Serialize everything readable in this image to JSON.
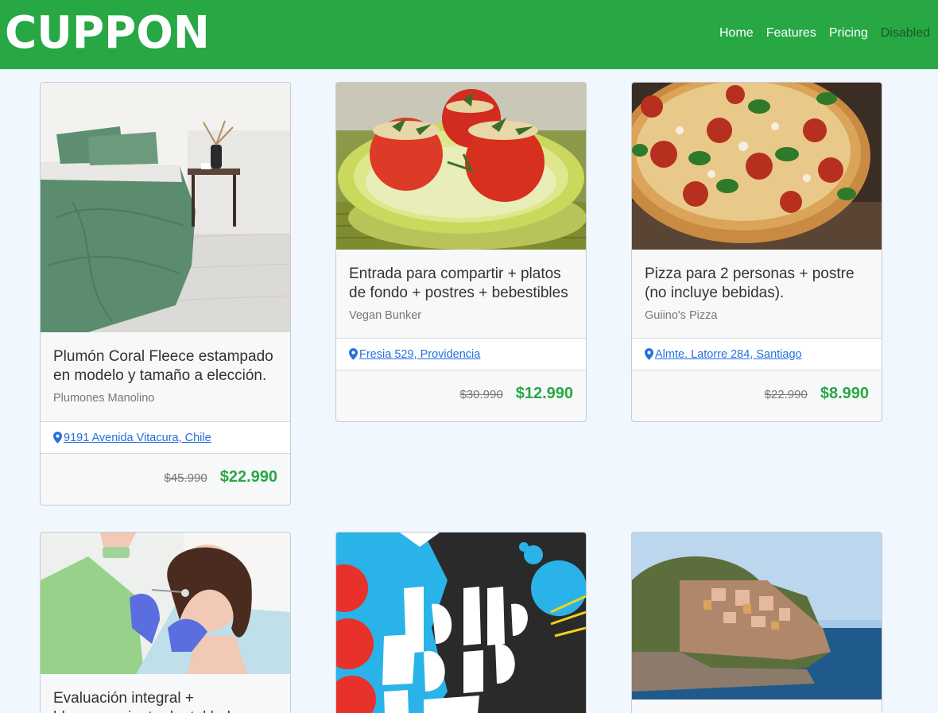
{
  "navbar": {
    "brand": "CUPPON",
    "links": [
      {
        "label": "Home"
      },
      {
        "label": "Features"
      },
      {
        "label": "Pricing"
      },
      {
        "label": "Disabled"
      }
    ]
  },
  "cards": [
    {
      "title": "Plumón Coral Fleece estampado en modelo y tamaño a elección.",
      "shop": "Plumones Manolino",
      "address": "9191 Avenida Vitacura, Chile",
      "old_price": "$45.990",
      "new_price": "$22.990"
    },
    {
      "title": "Entrada para compartir + platos de fondo + postres + bebestibles",
      "shop": "Vegan Bunker",
      "address": "Fresia 529, Providencia",
      "old_price": "$30.990",
      "new_price": "$12.990"
    },
    {
      "title": "Pizza para 2 personas + postre (no incluye bebidas).",
      "shop": "Guiino's Pizza",
      "address": "Almte. Latorre 284, Santiago",
      "old_price": "$22.990",
      "new_price": "$8.990"
    },
    {
      "title": "Evaluación integral + blanqueamiento dental led +"
    },
    {},
    {}
  ],
  "colors": {
    "navbar": "#28a745",
    "price": "#28a745",
    "link": "#2470e0",
    "page_bg": "#f0f7ff"
  }
}
